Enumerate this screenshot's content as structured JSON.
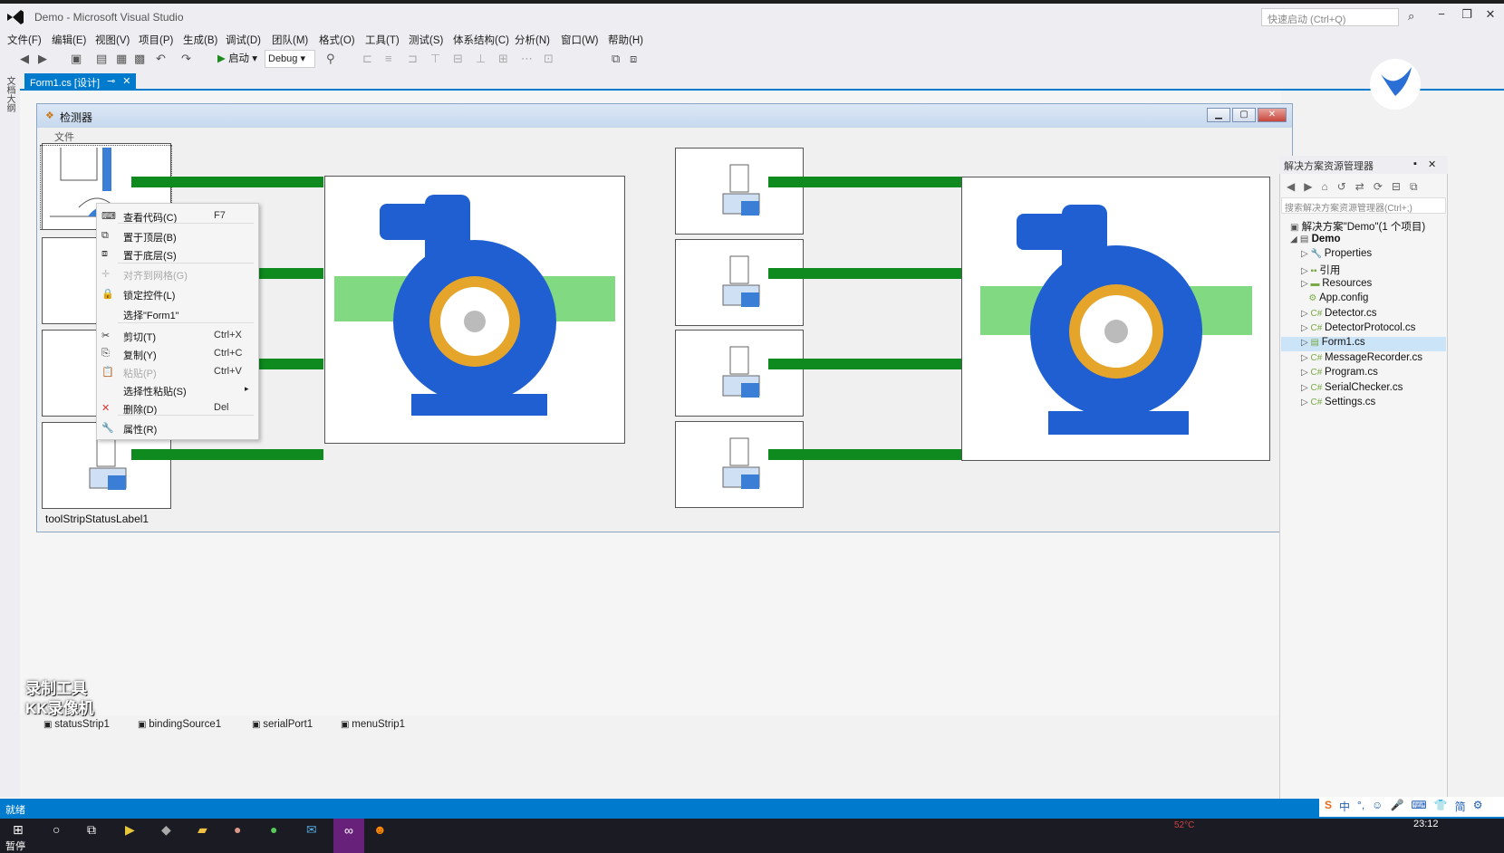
{
  "window": {
    "title": "Demo - Microsoft Visual Studio",
    "quick_launch_placeholder": "快速启动 (Ctrl+Q)"
  },
  "menu": [
    "文件(F)",
    "编辑(E)",
    "视图(V)",
    "项目(P)",
    "生成(B)",
    "调试(D)",
    "团队(M)",
    "格式(O)",
    "工具(T)",
    "测试(S)",
    "体系结构(C)",
    "分析(N)",
    "窗口(W)",
    "帮助(H)"
  ],
  "toolbar": {
    "start_label": "启动",
    "config_value": "Debug"
  },
  "left_rail_label": "文档大纲",
  "document_tab": {
    "label": "Form1.cs [设计]"
  },
  "form": {
    "title": "检测器",
    "menu_label": "文件",
    "status_label": "toolStripStatusLabel1"
  },
  "context_menu": [
    {
      "label": "查看代码(C)",
      "shortcut": "F7",
      "enabled": true,
      "icon": "code-icon"
    },
    {
      "label": "置于顶层(B)",
      "shortcut": "",
      "enabled": true,
      "icon": "bring-front-icon"
    },
    {
      "label": "置于底层(S)",
      "shortcut": "",
      "enabled": true,
      "icon": "send-back-icon"
    },
    {
      "label": "对齐到网格(G)",
      "shortcut": "",
      "enabled": false,
      "icon": "grid-icon"
    },
    {
      "label": "锁定控件(L)",
      "shortcut": "",
      "enabled": true,
      "icon": "lock-icon"
    },
    {
      "label": "选择\"Form1\"",
      "shortcut": "",
      "enabled": true,
      "icon": ""
    },
    {
      "label": "剪切(T)",
      "shortcut": "Ctrl+X",
      "enabled": true,
      "icon": "scissors-icon"
    },
    {
      "label": "复制(Y)",
      "shortcut": "Ctrl+C",
      "enabled": true,
      "icon": "copy-icon"
    },
    {
      "label": "粘贴(P)",
      "shortcut": "Ctrl+V",
      "enabled": false,
      "icon": "paste-icon"
    },
    {
      "label": "选择性粘贴(S)",
      "shortcut": "",
      "enabled": true,
      "icon": ""
    },
    {
      "label": "删除(D)",
      "shortcut": "Del",
      "enabled": true,
      "icon": "delete-icon"
    },
    {
      "label": "属性(R)",
      "shortcut": "",
      "enabled": true,
      "icon": "wrench-icon"
    }
  ],
  "solution_explorer": {
    "title": "解决方案资源管理器",
    "search_placeholder": "搜索解决方案资源管理器(Ctrl+;)",
    "solution": "解决方案\"Demo\"(1 个项目)",
    "project": "Demo",
    "items": [
      "Properties",
      "引用",
      "Resources",
      "App.config",
      "Detector.cs",
      "DetectorProtocol.cs",
      "Form1.cs",
      "MessageRecorder.cs",
      "Program.cs",
      "SerialChecker.cs",
      "Settings.cs"
    ],
    "selected": "Form1.cs"
  },
  "component_tray": [
    "statusStrip1",
    "bindingSource1",
    "serialPort1",
    "menuStrip1"
  ],
  "status_bar": {
    "text": "就绪"
  },
  "taskbar": {
    "clock": "23:12",
    "temp": "52°C"
  },
  "overlay": {
    "paused": "暂停",
    "watermark_line1": "录制工具",
    "watermark_line2": "KK录像机"
  },
  "colors": {
    "accent": "#007acc",
    "pipe": "#0f8a1e",
    "pump_blue": "#1f5fd1"
  }
}
